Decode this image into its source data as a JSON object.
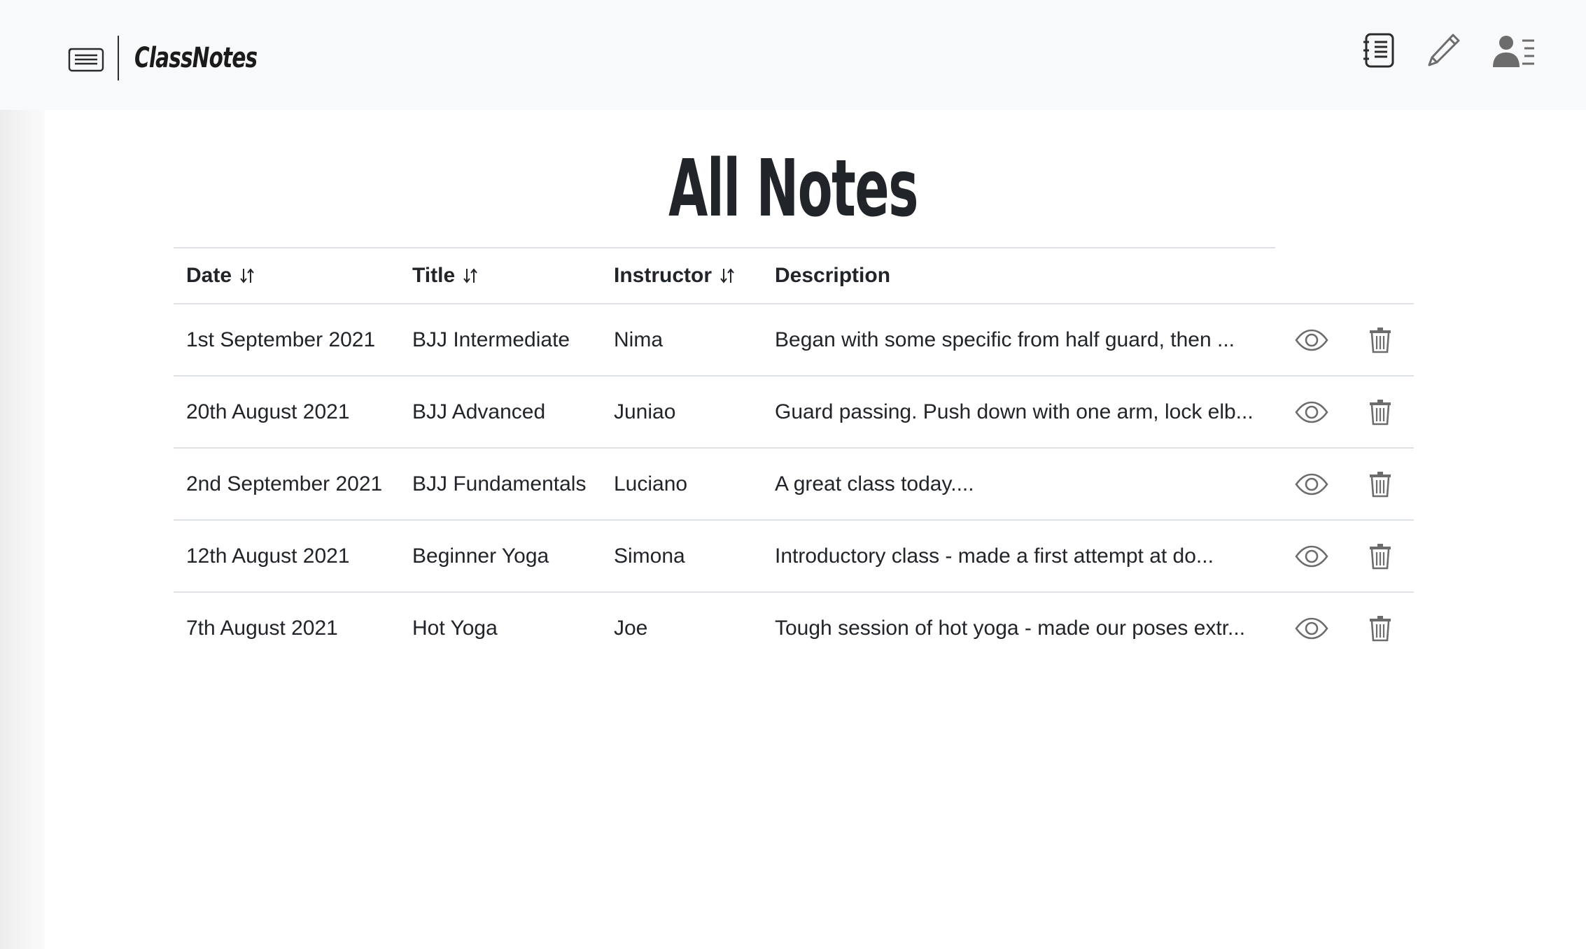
{
  "navbar": {
    "brand_name": "ClassNotes",
    "brand_icon": "newspaper-icon",
    "links": [
      {
        "name": "notes-list-link",
        "icon": "notebook-list-icon"
      },
      {
        "name": "new-note-link",
        "icon": "pencil-icon"
      },
      {
        "name": "profile-link",
        "icon": "user-profile-icon"
      }
    ]
  },
  "page": {
    "title": "All Notes"
  },
  "table": {
    "columns": [
      {
        "label": "Date",
        "sortable": true
      },
      {
        "label": "Title",
        "sortable": true
      },
      {
        "label": "Instructor",
        "sortable": true
      },
      {
        "label": "Description",
        "sortable": false
      }
    ],
    "rows": [
      {
        "date": "1st September 2021",
        "title": "BJJ Intermediate",
        "instructor": "Nima",
        "description": "Began with some specific from half guard, then ..."
      },
      {
        "date": "20th August 2021",
        "title": "BJJ Advanced",
        "instructor": "Juniao",
        "description": "Guard passing. Push down with one arm, lock elb..."
      },
      {
        "date": "2nd September 2021",
        "title": "BJJ Fundamentals",
        "instructor": "Luciano",
        "description": "A great class today...."
      },
      {
        "date": "12th August 2021",
        "title": "Beginner Yoga",
        "instructor": "Simona",
        "description": "Introductory class - made a first attempt at do..."
      },
      {
        "date": "7th August 2021",
        "title": "Hot Yoga",
        "instructor": "Joe",
        "description": "Tough session of hot yoga - made our poses extr..."
      }
    ],
    "row_actions": [
      "eye-icon",
      "trash-icon"
    ]
  },
  "colors": {
    "navbar_bg": "#f8f9fa",
    "text": "#212529",
    "icon": "#6c6c6c",
    "rule": "#dee2e6"
  }
}
